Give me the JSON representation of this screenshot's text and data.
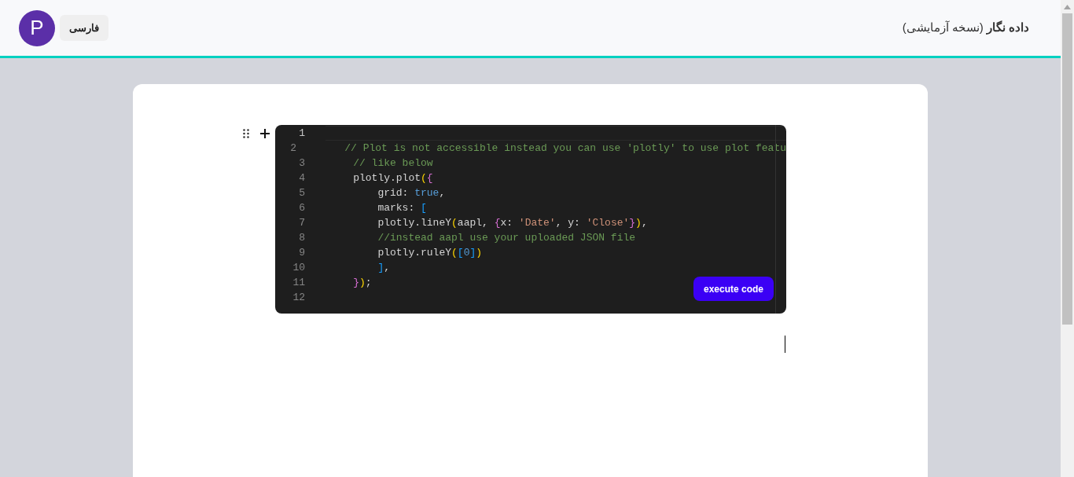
{
  "header": {
    "avatar_letter": "P",
    "language_button": "فارسی",
    "app_name": "داده نگار",
    "app_subtitle": "(نسخه آزمایشی)"
  },
  "editor": {
    "lines": [
      {
        "number": "1",
        "current": true
      },
      {
        "number": "2",
        "current": false,
        "tokens": [
          {
            "kind": "comment",
            "text": "// Plot is not accessible instead you can use 'plotly' to use plot featu"
          }
        ]
      },
      {
        "number": "3",
        "current": false,
        "tokens": [
          {
            "kind": "comment",
            "text": "// like below"
          }
        ]
      },
      {
        "number": "4",
        "current": false,
        "tokens": [
          {
            "kind": "plain",
            "text": "plotly.plot"
          },
          {
            "kind": "bracket1",
            "text": "("
          },
          {
            "kind": "bracket2",
            "text": "{"
          }
        ]
      },
      {
        "number": "5",
        "current": false,
        "tokens": [
          {
            "kind": "plain",
            "text": "grid: "
          },
          {
            "kind": "keyword",
            "text": "true"
          },
          {
            "kind": "plain",
            "text": ","
          }
        ]
      },
      {
        "number": "6",
        "current": false,
        "tokens": [
          {
            "kind": "plain",
            "text": "marks: "
          },
          {
            "kind": "bracket3",
            "text": "["
          }
        ]
      },
      {
        "number": "7",
        "current": false,
        "tokens": [
          {
            "kind": "plain",
            "text": "plotly.lineY"
          },
          {
            "kind": "bracket1",
            "text": "("
          },
          {
            "kind": "plain",
            "text": "aapl, "
          },
          {
            "kind": "bracket2",
            "text": "{"
          },
          {
            "kind": "plain",
            "text": "x: "
          },
          {
            "kind": "string",
            "text": "'Date'"
          },
          {
            "kind": "plain",
            "text": ", y: "
          },
          {
            "kind": "string",
            "text": "'Close'"
          },
          {
            "kind": "bracket2",
            "text": "}"
          },
          {
            "kind": "bracket1",
            "text": ")"
          },
          {
            "kind": "plain",
            "text": ","
          }
        ]
      },
      {
        "number": "8",
        "current": false,
        "tokens": [
          {
            "kind": "comment",
            "text": "//instead aapl use your uploaded JSON file"
          }
        ]
      },
      {
        "number": "9",
        "current": false,
        "tokens": [
          {
            "kind": "plain",
            "text": "plotly.ruleY"
          },
          {
            "kind": "bracket1",
            "text": "("
          },
          {
            "kind": "bracket3",
            "text": "["
          },
          {
            "kind": "keyword",
            "text": "0"
          },
          {
            "kind": "bracket3",
            "text": "]"
          },
          {
            "kind": "bracket1",
            "text": ")"
          }
        ]
      },
      {
        "number": "10",
        "current": false,
        "tokens": [
          {
            "kind": "bracket3",
            "text": "]"
          },
          {
            "kind": "plain",
            "text": ","
          }
        ]
      },
      {
        "number": "11",
        "current": false,
        "tokens": [
          {
            "kind": "bracket2",
            "text": "}"
          },
          {
            "kind": "bracket1",
            "text": ")"
          },
          {
            "kind": "plain",
            "text": ";"
          }
        ]
      },
      {
        "number": "12",
        "current": false
      }
    ],
    "run_button": "execute code"
  }
}
